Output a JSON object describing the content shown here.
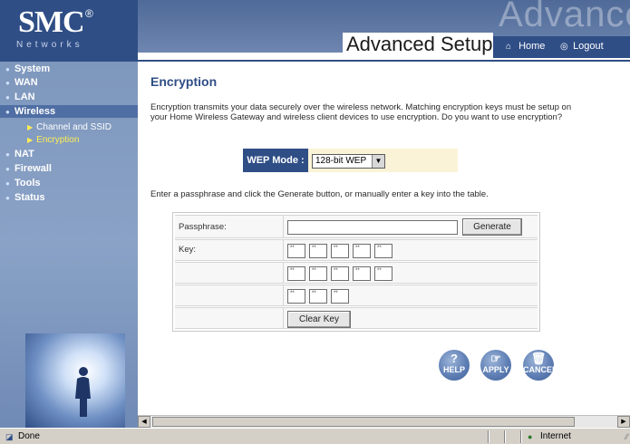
{
  "brand": {
    "logo": "SMC",
    "registered": "®",
    "subtitle": "Networks"
  },
  "header": {
    "watermark": "Advanced Setup",
    "title": "Advanced Setup",
    "home_label": "Home",
    "logout_label": "Logout"
  },
  "sidebar": {
    "items": [
      {
        "label": "System"
      },
      {
        "label": "WAN"
      },
      {
        "label": "LAN"
      },
      {
        "label": "Wireless"
      },
      {
        "label": "NAT"
      },
      {
        "label": "Firewall"
      },
      {
        "label": "Tools"
      },
      {
        "label": "Status"
      }
    ],
    "subitems": [
      {
        "label": "Channel and SSID"
      },
      {
        "label": "Encryption"
      }
    ]
  },
  "main": {
    "title": "Encryption",
    "intro": "Encryption transmits your data securely over the wireless network. Matching encryption keys must be setup on your Home Wireless Gateway and wireless client devices to use encryption. Do you want to use encryption?",
    "wep_label": "WEP Mode :",
    "wep_value": "128-bit WEP",
    "instructions": "Enter a passphrase and click the Generate button, or manually enter a key into the table.",
    "passphrase_label": "Passphrase:",
    "passphrase_value": "",
    "generate_label": "Generate",
    "key_label": "Key:",
    "key_rows": [
      [
        "**",
        "**",
        "**",
        "**",
        "**"
      ],
      [
        "**",
        "**",
        "**",
        "**",
        "**"
      ],
      [
        "**",
        "**",
        "**"
      ]
    ],
    "clear_label": "Clear Key"
  },
  "actions": {
    "help": "HELP",
    "apply": "APPLY",
    "cancel": "CANCEL"
  },
  "statusbar": {
    "text": "Done",
    "zone": "Internet"
  },
  "colors": {
    "brand_blue": "#2f4e86",
    "sidebar_blue": "#8aa2c6",
    "highlight_yellow": "#ffee55",
    "wep_bg": "#fbf3d7"
  },
  "icons": {
    "home": "house-icon",
    "logout": "power-icon",
    "nav_bullet": "circle-bullet-icon",
    "sub_bullet": "triangle-right-icon",
    "status": "ie-page-icon",
    "zone": "globe-icon"
  }
}
